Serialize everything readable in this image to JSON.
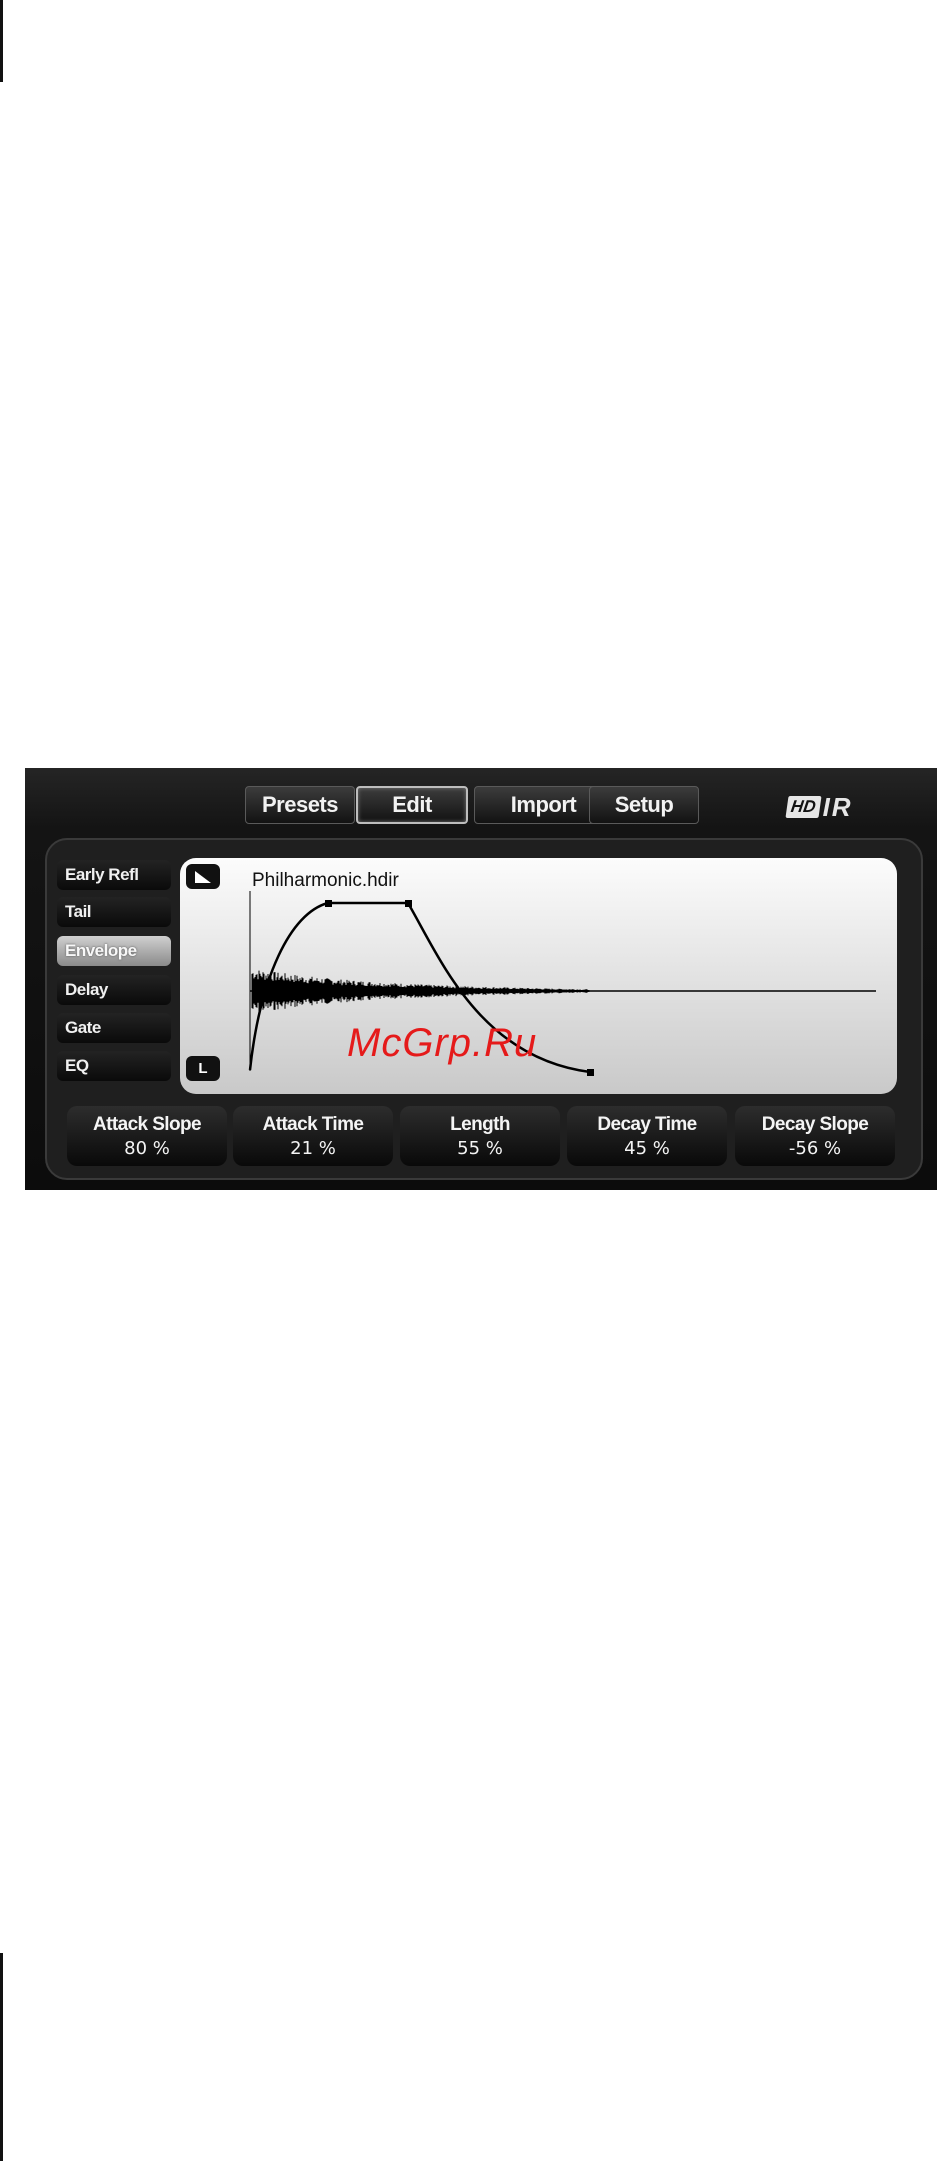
{
  "top_nav": {
    "presets": "Presets",
    "edit": "Edit",
    "import": "Import",
    "setup": "Setup",
    "active": "Edit"
  },
  "logo": {
    "hd": "HD",
    "ir": "IR"
  },
  "side_nav": {
    "items": [
      "Early Refl",
      "Tail",
      "Envelope",
      "Delay",
      "Gate",
      "EQ"
    ],
    "active": "Envelope"
  },
  "display": {
    "file_name": "Philharmonic.hdir",
    "lr_button": "L",
    "shape_icon": "envelope-shape-icon"
  },
  "watermark": "McGrp.Ru",
  "params": [
    {
      "label": "Attack Slope",
      "value": "80 %"
    },
    {
      "label": "Attack Time",
      "value": "21 %"
    },
    {
      "label": "Length",
      "value": "55 %"
    },
    {
      "label": "Decay Time",
      "value": "45 %"
    },
    {
      "label": "Decay Slope",
      "value": "-56 %"
    }
  ],
  "colors": {
    "active_tab": "#bdbdbd",
    "display_bg": "#e6e6e6",
    "curve": "#000000"
  }
}
